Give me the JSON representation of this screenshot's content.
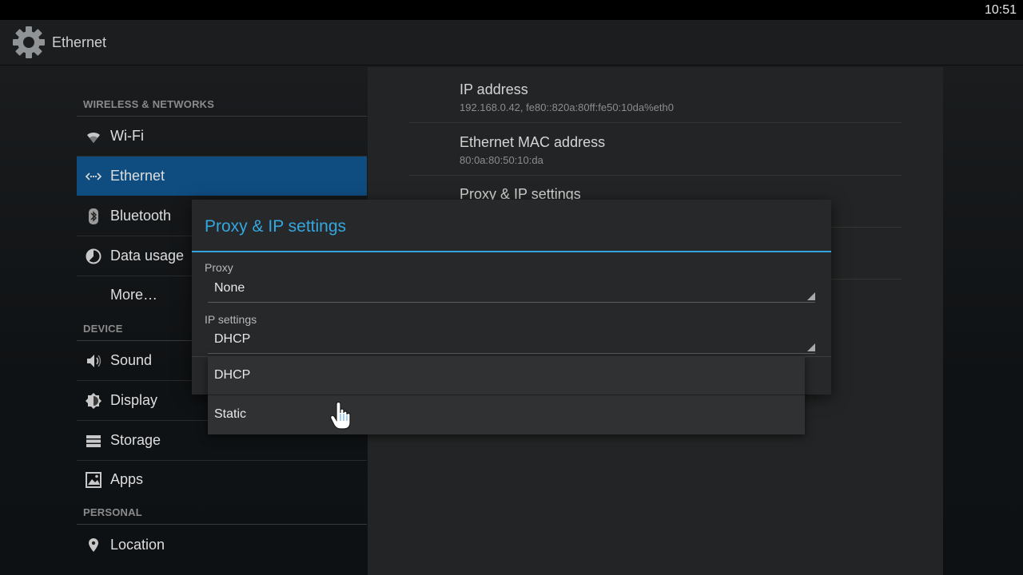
{
  "status_bar": {
    "time": "10:51"
  },
  "action_bar": {
    "title": "Ethernet",
    "icon": "gear-icon"
  },
  "sidebar": {
    "sections": {
      "wireless": "WIRELESS & NETWORKS",
      "device": "DEVICE",
      "personal": "PERSONAL"
    },
    "items": {
      "wifi": {
        "label": "Wi-Fi",
        "icon": "wifi-icon"
      },
      "ethernet": {
        "label": "Ethernet",
        "icon": "ethernet-icon",
        "selected": true
      },
      "bluetooth": {
        "label": "Bluetooth",
        "icon": "bluetooth-icon"
      },
      "data_usage": {
        "label": "Data usage",
        "icon": "data-usage-icon"
      },
      "more": {
        "label": "More…"
      },
      "sound": {
        "label": "Sound",
        "icon": "speaker-icon"
      },
      "display": {
        "label": "Display",
        "icon": "brightness-icon"
      },
      "storage": {
        "label": "Storage",
        "icon": "storage-icon"
      },
      "apps": {
        "label": "Apps",
        "icon": "apps-icon"
      },
      "location": {
        "label": "Location",
        "icon": "location-pin-icon"
      }
    }
  },
  "details": {
    "ip": {
      "title": "IP address",
      "value": "192.168.0.42, fe80::820a:80ff:fe50:10da%eth0"
    },
    "mac": {
      "title": "Ethernet MAC address",
      "value": "80:0a:80:50:10:da"
    },
    "proxy_ip_partial": "Proxy & IP settings"
  },
  "dialog": {
    "title": "Proxy & IP settings",
    "proxy_label": "Proxy",
    "proxy_value": "None",
    "ip_label": "IP settings",
    "ip_value": "DHCP"
  },
  "dropdown": {
    "options": [
      "DHCP",
      "Static"
    ]
  },
  "colors": {
    "accent": "#33a5de",
    "selected_bg": "#0f4d80",
    "dialog_bg": "#272829"
  }
}
